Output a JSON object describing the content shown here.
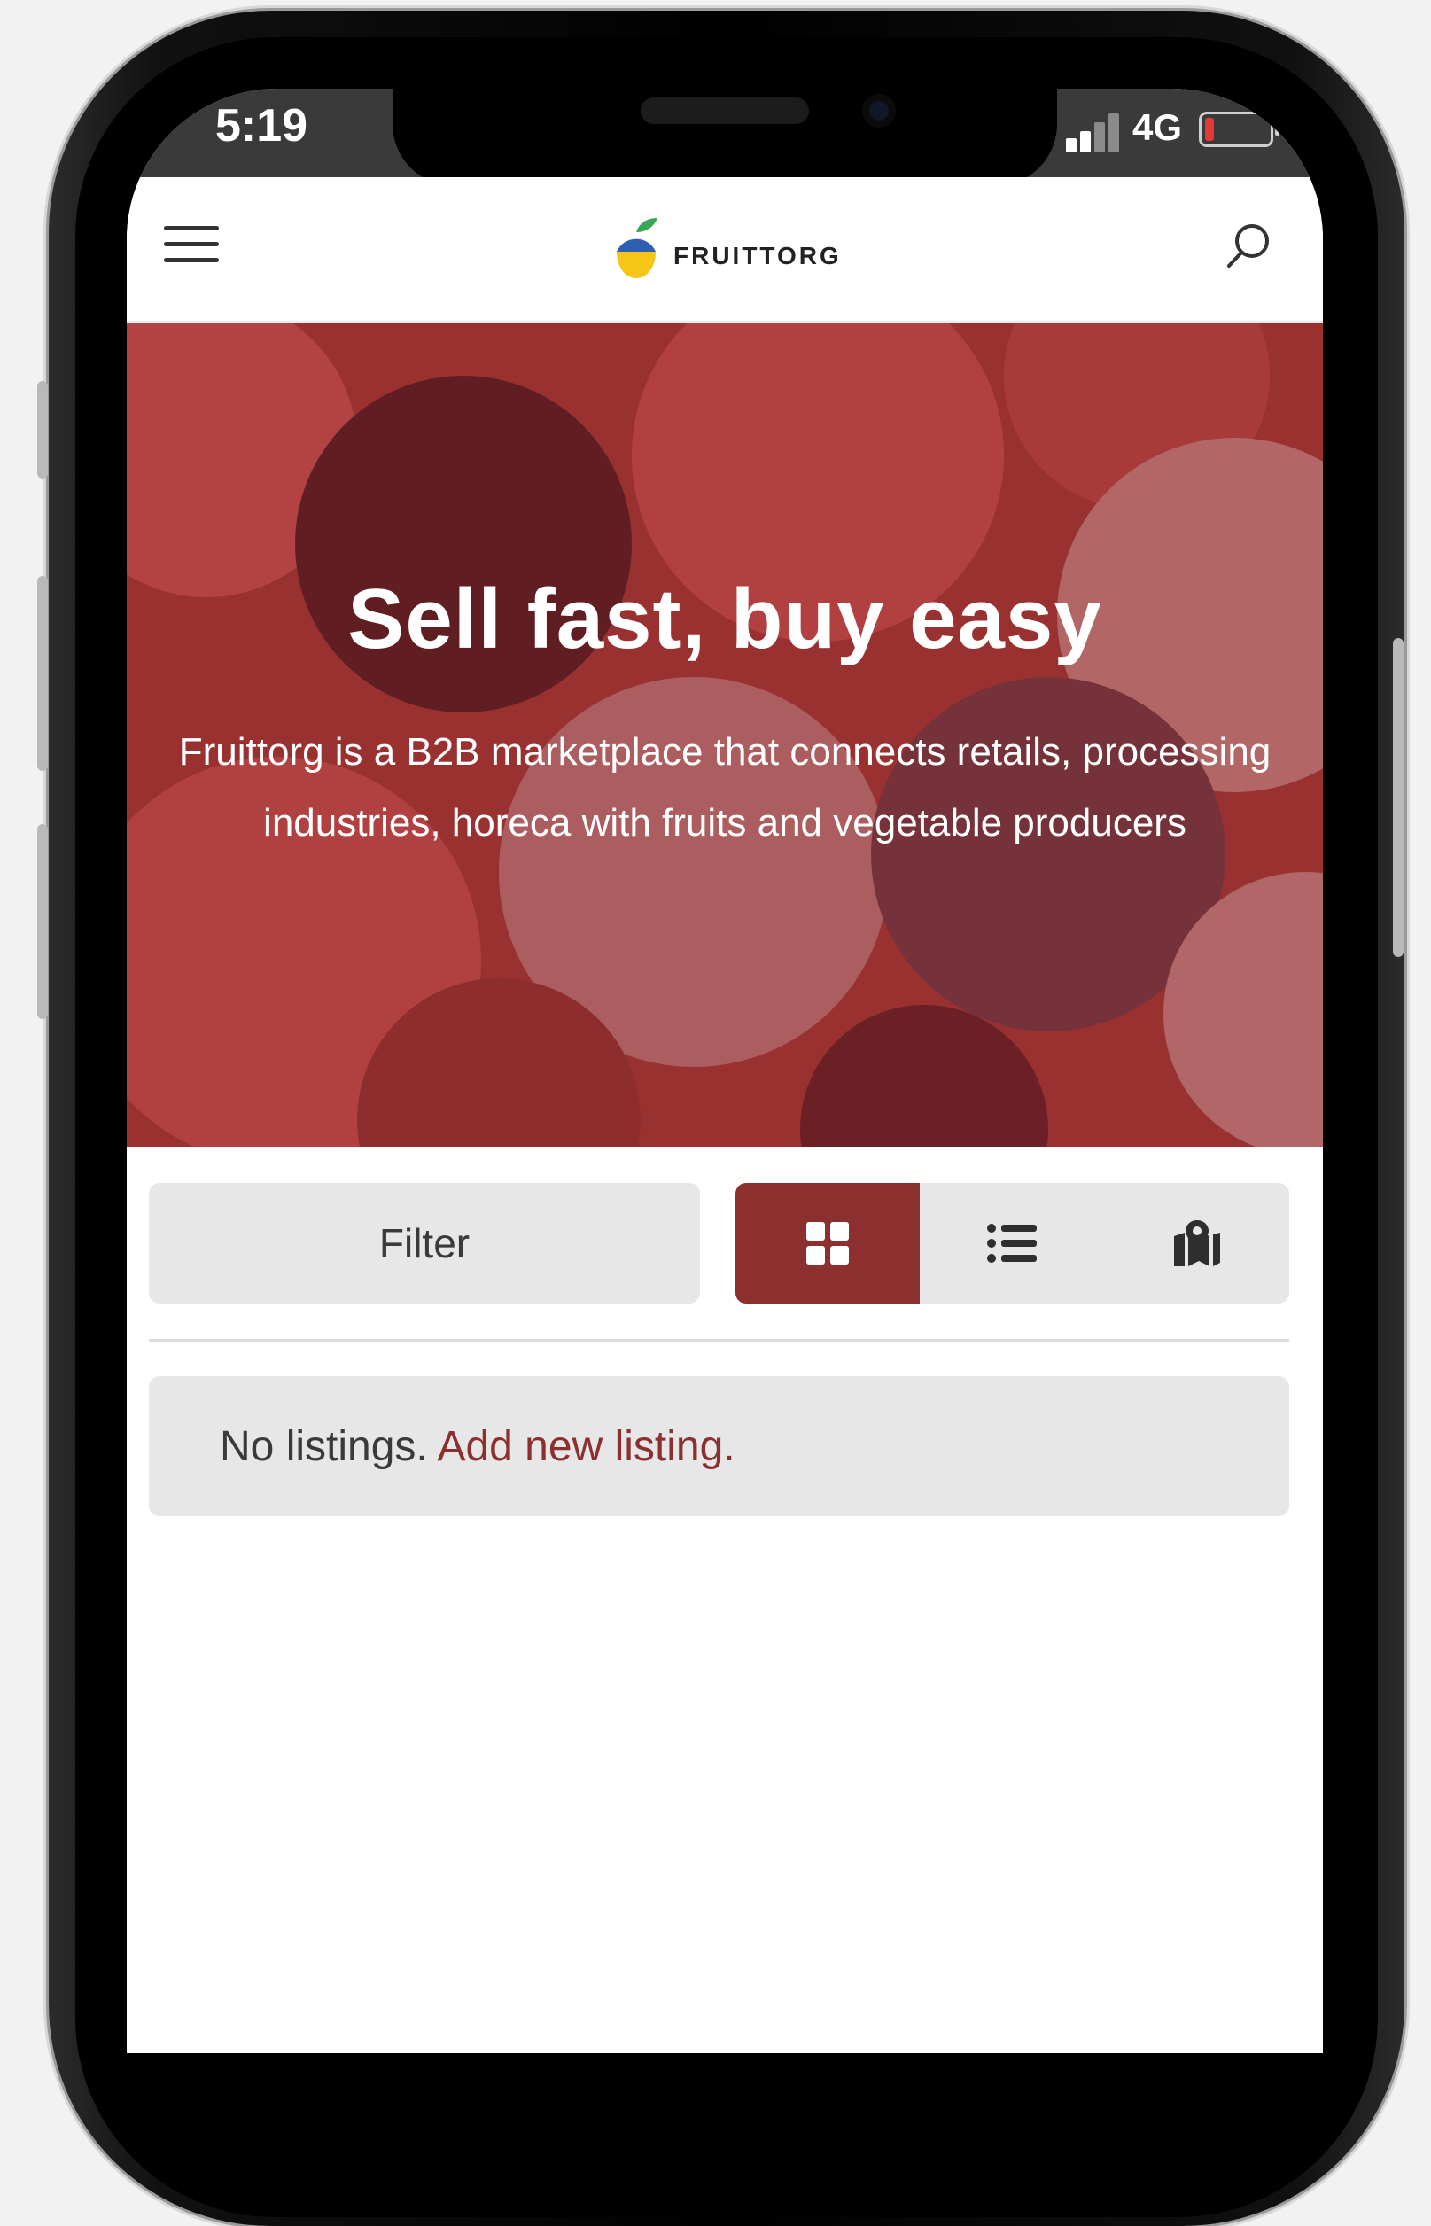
{
  "status_bar": {
    "time": "5:19",
    "network": "4G"
  },
  "header": {
    "brand": "FRUITTORG",
    "menu_icon": "hamburger-menu-icon",
    "search_icon": "search-icon"
  },
  "hero": {
    "title": "Sell fast, buy easy",
    "subtitle": "Fruittorg is a B2B marketplace that connects retails, processing industries, horeca with fruits and vegetable producers"
  },
  "toolbar": {
    "filter_label": "Filter",
    "views": [
      {
        "name": "grid",
        "icon": "grid-view-icon",
        "active": true
      },
      {
        "name": "list",
        "icon": "list-view-icon",
        "active": false
      },
      {
        "name": "map",
        "icon": "map-view-icon",
        "active": false
      }
    ]
  },
  "listings": {
    "empty_text": "No listings.",
    "add_link": "Add new listing."
  },
  "colors": {
    "accent": "#8b2f2f",
    "hero_tint": "#a73b3b",
    "button_bg": "#e7e7e7"
  }
}
